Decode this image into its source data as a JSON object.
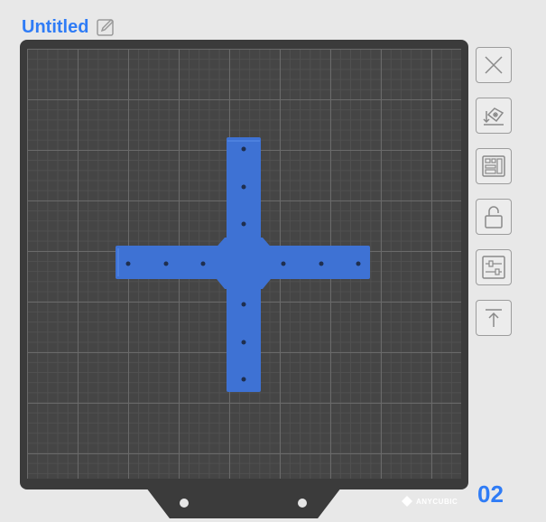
{
  "plate": {
    "title": "Untitled",
    "number": "02",
    "brand": "ANYCUBIC"
  },
  "colors": {
    "accent": "#2f7cf6",
    "model": "#3e72d4",
    "bed": "#3b3b3b"
  },
  "icons": {
    "edit": "pencil-square-icon",
    "tools": [
      "close-x-icon",
      "auto-orient-icon",
      "auto-arrange-icon",
      "lock-icon",
      "adjust-sliders-icon",
      "move-to-top-icon"
    ]
  }
}
